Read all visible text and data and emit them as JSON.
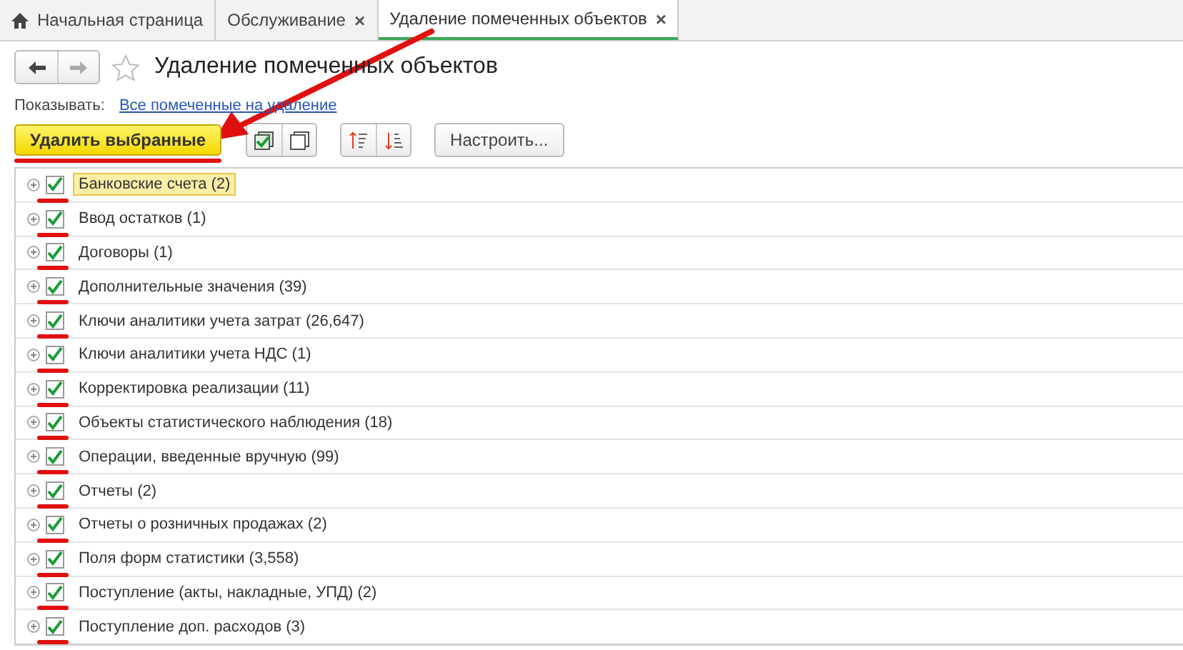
{
  "tabs": [
    {
      "label": "Начальная страница",
      "kind": "home",
      "selected": false
    },
    {
      "label": "Обслуживание",
      "kind": "closable",
      "selected": false
    },
    {
      "label": "Удаление помеченных объектов",
      "kind": "closable",
      "selected": true
    }
  ],
  "close_glyph": "×",
  "form": {
    "title": "Удаление помеченных объектов",
    "favorite": false
  },
  "filter": {
    "label": "Показывать:",
    "link": "Все помеченные на удаление"
  },
  "toolbar": {
    "delete_button": {
      "label": "Удалить выбранные",
      "underlined": true
    },
    "settings_button": "Настроить..."
  },
  "tree": {
    "rows": [
      {
        "label": "Банковские счета (2)",
        "checked": true,
        "selected": true,
        "underlined": true
      },
      {
        "label": "Ввод остатков (1)",
        "checked": true,
        "selected": false,
        "underlined": true
      },
      {
        "label": "Договоры (1)",
        "checked": true,
        "selected": false,
        "underlined": true
      },
      {
        "label": "Дополнительные значения (39)",
        "checked": true,
        "selected": false,
        "underlined": true
      },
      {
        "label": "Ключи аналитики учета затрат (26,647)",
        "checked": true,
        "selected": false,
        "underlined": true
      },
      {
        "label": "Ключи аналитики учета НДС (1)",
        "checked": true,
        "selected": false,
        "underlined": true
      },
      {
        "label": "Корректировка реализации (11)",
        "checked": true,
        "selected": false,
        "underlined": true
      },
      {
        "label": "Объекты статистического наблюдения (18)",
        "checked": true,
        "selected": false,
        "underlined": true
      },
      {
        "label": "Операции, введенные вручную (99)",
        "checked": true,
        "selected": false,
        "underlined": true
      },
      {
        "label": "Отчеты (2)",
        "checked": true,
        "selected": false,
        "underlined": true
      },
      {
        "label": "Отчеты о розничных продажах (2)",
        "checked": true,
        "selected": false,
        "underlined": true
      },
      {
        "label": "Поля форм статистики (3,558)",
        "checked": true,
        "selected": false,
        "underlined": true
      },
      {
        "label": "Поступление (акты, накладные, УПД) (2)",
        "checked": true,
        "selected": false,
        "underlined": true
      },
      {
        "label": "Поступление доп. расходов (3)",
        "checked": true,
        "selected": false,
        "underlined": true
      }
    ]
  }
}
